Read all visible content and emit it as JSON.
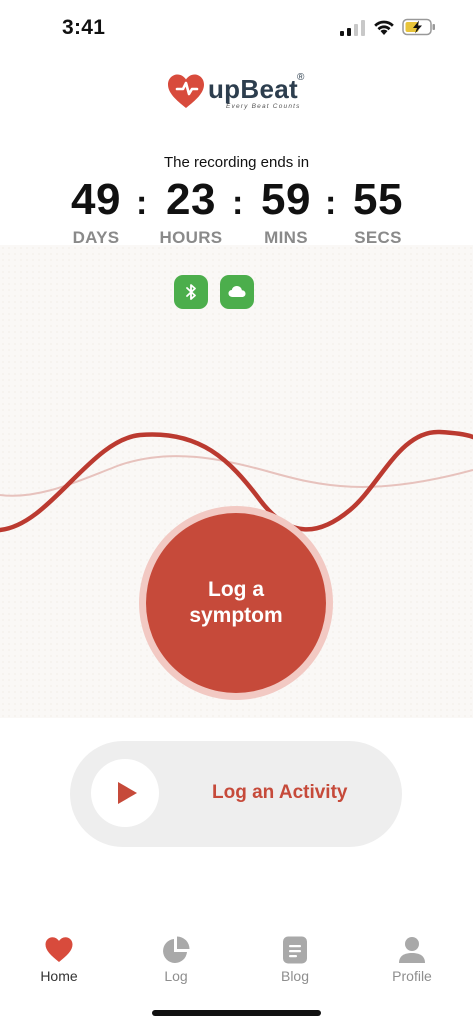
{
  "status_bar": {
    "time": "3:41"
  },
  "logo": {
    "name": "upBeat",
    "registered": "®",
    "tagline": "Every Beat Counts"
  },
  "recording": {
    "label": "The recording ends in",
    "countdown": [
      {
        "value": "49",
        "unit": "DAYS"
      },
      {
        "value": "23",
        "unit": "HOURS"
      },
      {
        "value": "59",
        "unit": "MINS"
      },
      {
        "value": "55",
        "unit": "SECS"
      }
    ],
    "separator": ":"
  },
  "connections": [
    {
      "icon": "bluetooth-icon",
      "color": "#4cae4c"
    },
    {
      "icon": "cloud-icon",
      "color": "#4cae4c"
    }
  ],
  "symptom_button": {
    "label": "Log a symptom"
  },
  "activity_button": {
    "label": "Log an Activity"
  },
  "tabs": [
    {
      "label": "Home",
      "icon": "heart-icon",
      "active": true
    },
    {
      "label": "Log",
      "icon": "pie-chart-icon",
      "active": false
    },
    {
      "label": "Blog",
      "icon": "document-icon",
      "active": false
    },
    {
      "label": "Profile",
      "icon": "person-icon",
      "active": false
    }
  ],
  "colors": {
    "accent": "#c64a3a",
    "connected": "#4cae4c",
    "muted": "#8a8a8a"
  }
}
